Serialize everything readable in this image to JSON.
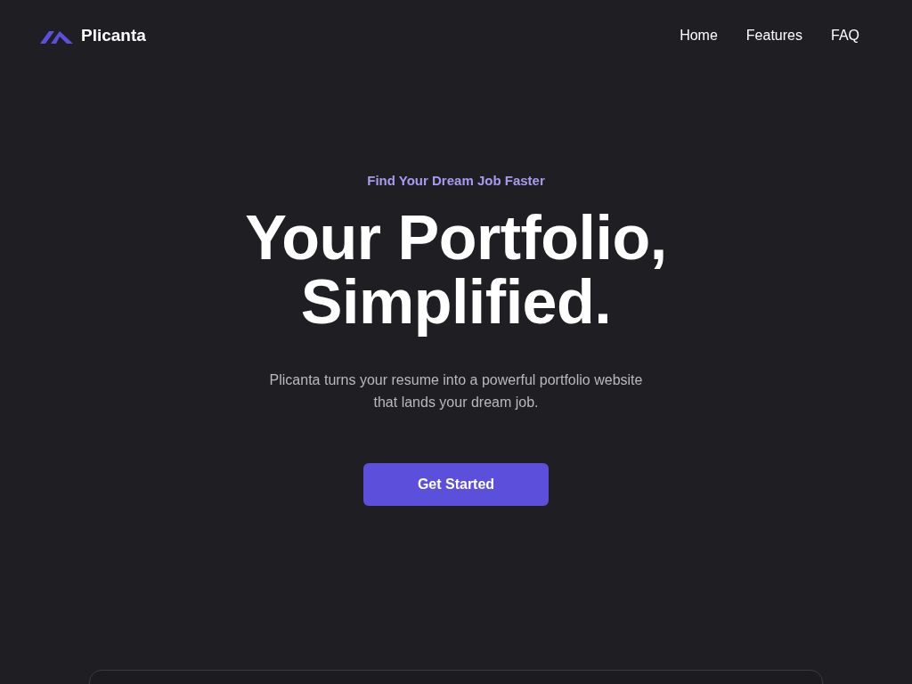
{
  "brand": {
    "name": "Plicanta"
  },
  "nav": [
    {
      "label": "Home"
    },
    {
      "label": "Features"
    },
    {
      "label": "FAQ"
    }
  ],
  "hero": {
    "tagline": "Find Your Dream Job Faster",
    "headline": [
      "Your Portfolio,",
      "Simplified."
    ],
    "description": "Plicanta turns your resume into a powerful portfolio website that lands your dream job.",
    "button": "Get Started"
  }
}
